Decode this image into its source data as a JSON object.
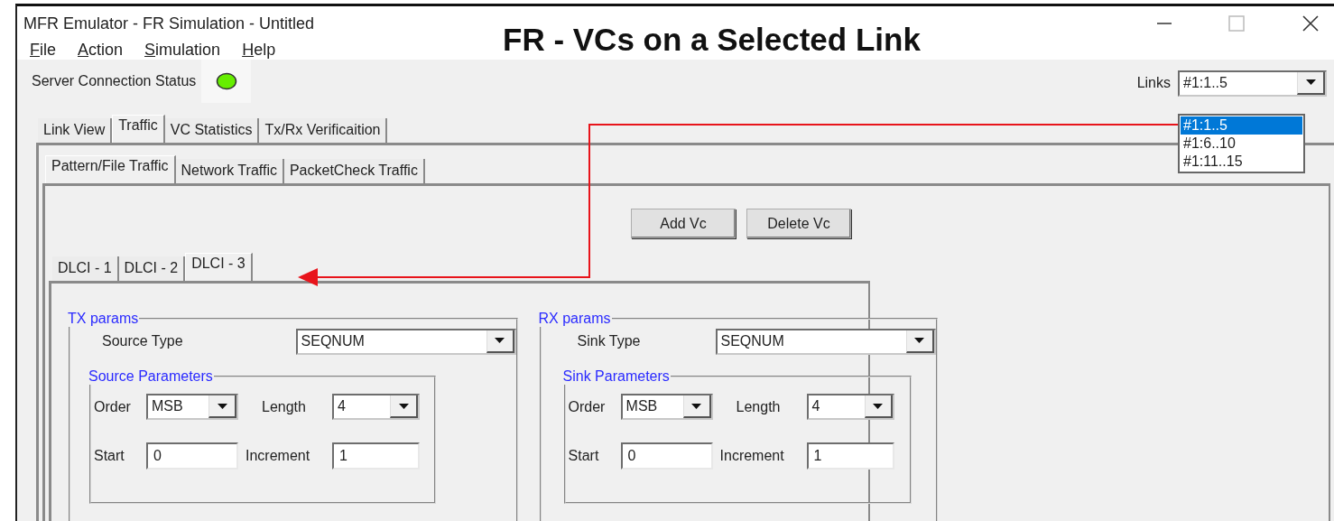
{
  "window": {
    "title": "MFR Emulator - FR Simulation - Untitled"
  },
  "annotation": {
    "title": "FR - VCs on a Selected Link"
  },
  "menu": [
    "File",
    "Action",
    "Simulation",
    "Help"
  ],
  "server_status": {
    "label": "Server Connection Status",
    "connected": true
  },
  "links": {
    "label": "Links",
    "value": "#1:1..5",
    "options": [
      {
        "label": "#1:1..5",
        "selected": true
      },
      {
        "label": "#1:6..10",
        "selected": false
      },
      {
        "label": "#1:11..15",
        "selected": false
      }
    ]
  },
  "tabs": [
    {
      "label": "Link View",
      "selected": false
    },
    {
      "label": "Traffic",
      "selected": true
    },
    {
      "label": "VC Statistics",
      "selected": false
    },
    {
      "label": "Tx/Rx Verificaition",
      "selected": false
    }
  ],
  "sub_tabs": [
    {
      "label": "Pattern/File Traffic",
      "selected": true
    },
    {
      "label": "Network Traffic",
      "selected": false
    },
    {
      "label": "PacketCheck Traffic",
      "selected": false
    }
  ],
  "buttons": [
    "Add Vc",
    "Delete Vc"
  ],
  "vc_tabs": [
    {
      "label": "DLCI - 1",
      "selected": false
    },
    {
      "label": "DLCI - 2",
      "selected": false
    },
    {
      "label": "DLCI - 3",
      "selected": true
    }
  ],
  "groups": [
    {
      "title": "TX params",
      "type_label": "Source Type",
      "type_value": "SEQNUM",
      "params_title": "Source Parameters",
      "order_label": "Order",
      "order": "MSB",
      "length_label": "Length",
      "length": "4",
      "start_label": "Start",
      "start": "0",
      "increment_label": "Increment",
      "increment": "1"
    },
    {
      "title": "RX params",
      "type_label": "Sink Type",
      "type_value": "SEQNUM",
      "params_title": "Sink Parameters",
      "order_label": "Order",
      "order": "MSB",
      "length_label": "Length",
      "length": "4",
      "start_label": "Start",
      "start": "0",
      "increment_label": "Increment",
      "increment": "1"
    }
  ]
}
